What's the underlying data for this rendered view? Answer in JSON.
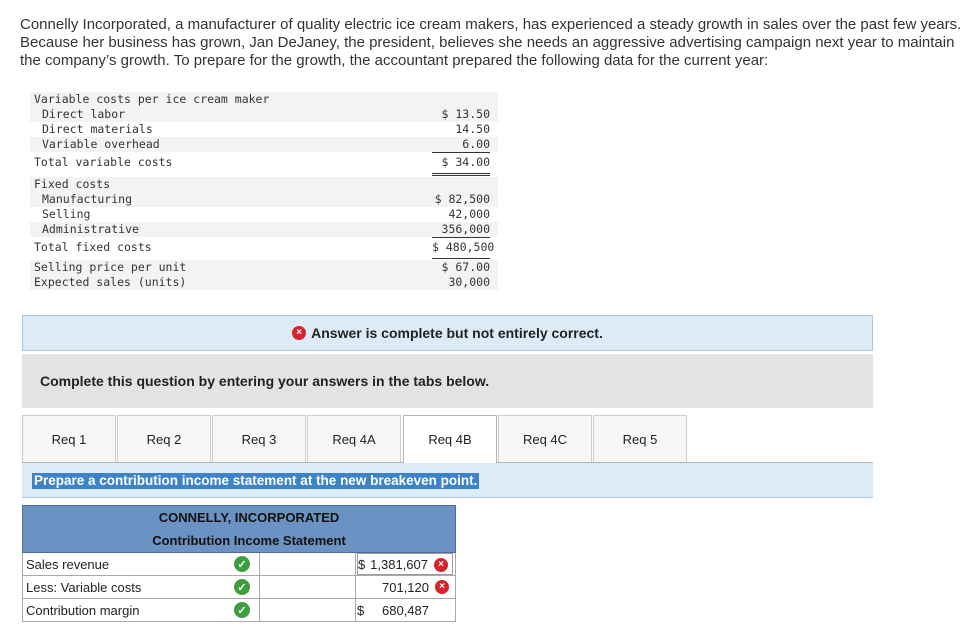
{
  "intro_text": "Connelly Incorporated, a manufacturer of quality electric ice cream makers, has experienced a steady growth in sales over the past few years. Because her business has grown, Jan DeJaney, the president, believes she needs an aggressive advertising campaign next year to maintain the company’s growth. To prepare for the growth, the accountant prepared the following data for the current year:",
  "data_table": [
    {
      "label": "Variable costs per ice cream maker",
      "value": ""
    },
    {
      "label": "Direct labor",
      "value": "$ 13.50"
    },
    {
      "label": "Direct materials",
      "value": "14.50"
    },
    {
      "label": "Variable overhead",
      "value": "6.00"
    },
    {
      "label": "Total variable costs",
      "value": "$ 34.00"
    },
    {
      "label": "Fixed costs",
      "value": ""
    },
    {
      "label": "Manufacturing",
      "value": "$ 82,500"
    },
    {
      "label": "Selling",
      "value": "42,000"
    },
    {
      "label": "Administrative",
      "value": "356,000"
    },
    {
      "label": "Total fixed costs",
      "value": "$ 480,500"
    },
    {
      "label": "Selling price per unit",
      "value": "$ 67.00"
    },
    {
      "label": "Expected sales (units)",
      "value": "30,000"
    }
  ],
  "feedback": {
    "text": "Answer is complete but not entirely correct.",
    "icon": "×"
  },
  "instruction": "Complete this question by entering your answers in the tabs below.",
  "tabs": [
    {
      "label": "Req 1"
    },
    {
      "label": "Req 2"
    },
    {
      "label": "Req 3"
    },
    {
      "label": "Req 4A"
    },
    {
      "label": "Req 4B"
    },
    {
      "label": "Req 4C"
    },
    {
      "label": "Req 5"
    }
  ],
  "active_tab": "Req 4B",
  "prompt": "Prepare a contribution income statement at the new breakeven point.",
  "statement": {
    "company": "CONNELLY, INCORPORATED",
    "title": "Contribution Income Statement",
    "rows": [
      {
        "label": "Sales revenue",
        "dollar": "$",
        "amount": "1,381,607",
        "correct": false
      },
      {
        "label": "Less: Variable costs",
        "dollar": "",
        "amount": "701,120",
        "correct": false
      },
      {
        "label": "Contribution margin",
        "dollar": "$",
        "amount": "680,487",
        "correct": null
      }
    ]
  },
  "colors": {
    "accent": "#3d83c8",
    "header_blue": "#6c92c3",
    "correct_green": "#3c9e3c",
    "incorrect_red": "#d6242e",
    "light_blue": "#dcebf6"
  }
}
